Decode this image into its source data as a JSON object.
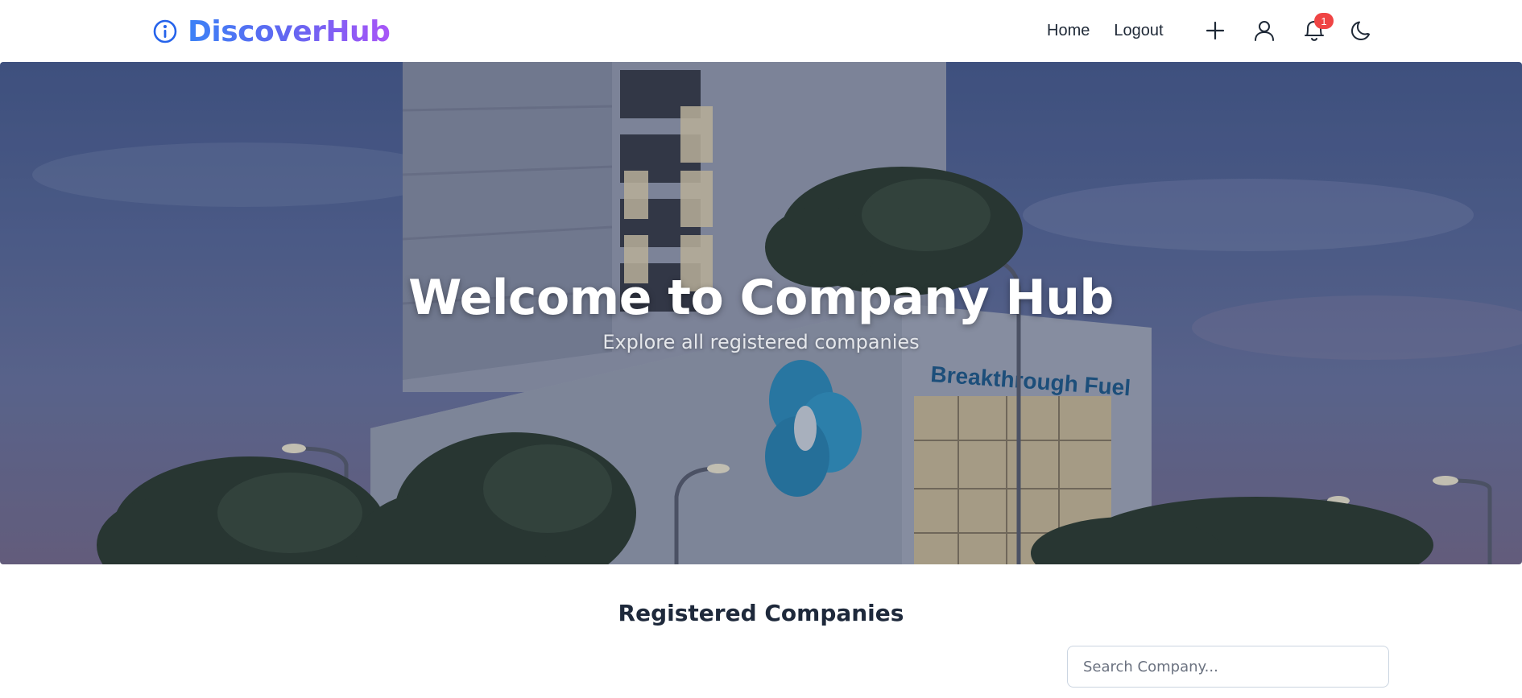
{
  "brand": {
    "name": "DiscoverHub",
    "icon": "info-circle-icon"
  },
  "nav": {
    "links": [
      "Home",
      "Logout"
    ],
    "icons": [
      "plus-icon",
      "user-icon",
      "bell-icon",
      "moon-icon"
    ],
    "notification_count": "1"
  },
  "hero": {
    "title": "Welcome to Company Hub",
    "subtitle": "Explore all registered companies",
    "building_sign": "Breakthrough Fuel"
  },
  "section": {
    "title": "Registered Companies",
    "search_placeholder": "Search Company..."
  },
  "colors": {
    "brand_gradient_start": "#3b82f6",
    "brand_gradient_end": "#a855f7",
    "badge": "#ef4444",
    "heading": "#1e293b"
  }
}
